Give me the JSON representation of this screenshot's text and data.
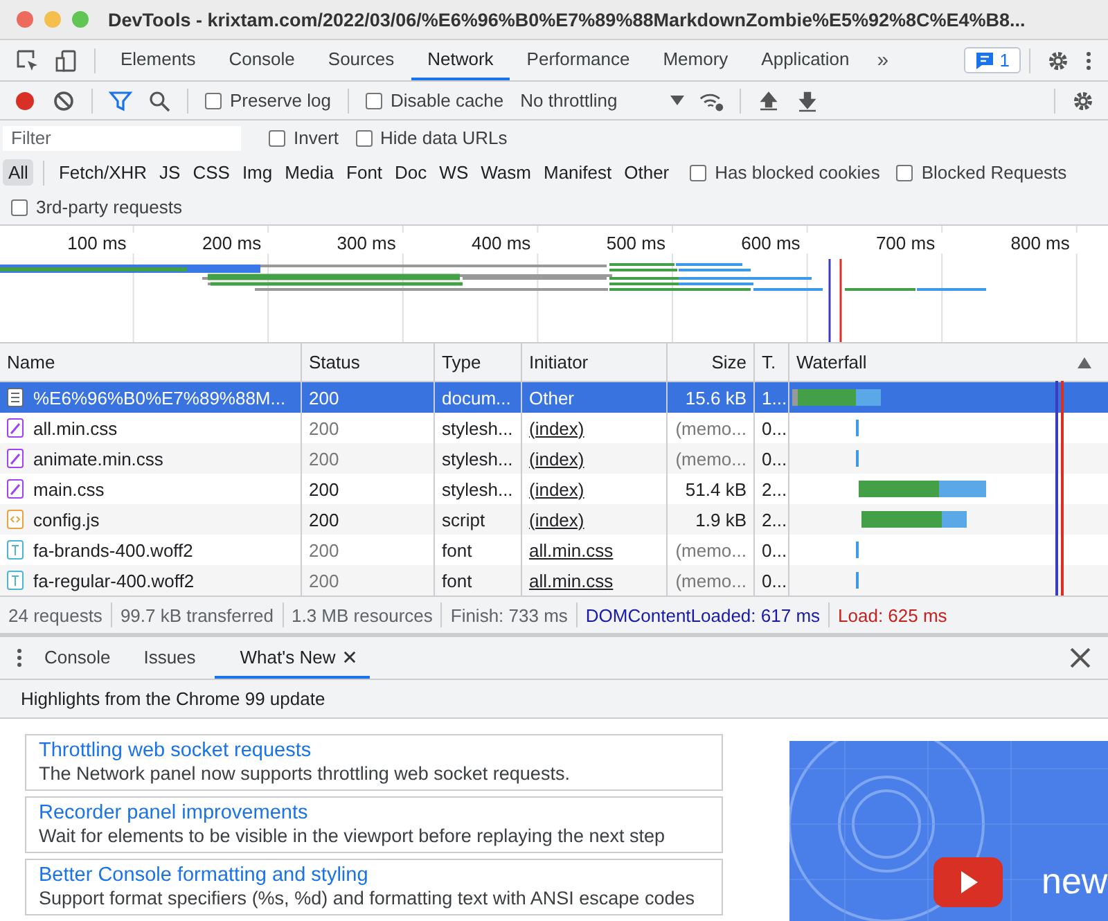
{
  "window": {
    "title": "DevTools - krixtam.com/2022/03/06/%E6%96%B0%E7%89%88MarkdownZombie%E5%92%8C%E4%B8..."
  },
  "tabs": [
    {
      "label": "Elements",
      "selected": false
    },
    {
      "label": "Console",
      "selected": false
    },
    {
      "label": "Sources",
      "selected": false
    },
    {
      "label": "Network",
      "selected": true
    },
    {
      "label": "Performance",
      "selected": false
    },
    {
      "label": "Memory",
      "selected": false
    },
    {
      "label": "Application",
      "selected": false
    }
  ],
  "more_tabs": "»",
  "issues_badge": "1",
  "toolbar": {
    "preserve_log": {
      "label": "Preserve log",
      "checked": false
    },
    "disable_cache": {
      "label": "Disable cache",
      "checked": false
    },
    "throttling": "No throttling"
  },
  "filter": {
    "placeholder": "Filter",
    "invert": {
      "label": "Invert",
      "checked": false
    },
    "hide_data_urls": {
      "label": "Hide data URLs",
      "checked": false
    }
  },
  "type_filters": [
    {
      "label": "All",
      "selected": true
    },
    {
      "label": "Fetch/XHR",
      "selected": false
    },
    {
      "label": "JS",
      "selected": false
    },
    {
      "label": "CSS",
      "selected": false
    },
    {
      "label": "Img",
      "selected": false
    },
    {
      "label": "Media",
      "selected": false
    },
    {
      "label": "Font",
      "selected": false
    },
    {
      "label": "Doc",
      "selected": false
    },
    {
      "label": "WS",
      "selected": false
    },
    {
      "label": "Wasm",
      "selected": false
    },
    {
      "label": "Manifest",
      "selected": false
    },
    {
      "label": "Other",
      "selected": false
    }
  ],
  "blocked_cookies": {
    "label": "Has blocked cookies",
    "checked": false
  },
  "blocked_requests": {
    "label": "Blocked Requests",
    "checked": false
  },
  "third_party": {
    "label": "3rd-party requests",
    "checked": false
  },
  "overview_ticks": [
    "100 ms",
    "200 ms",
    "300 ms",
    "400 ms",
    "500 ms",
    "600 ms",
    "700 ms",
    "800 ms"
  ],
  "table": {
    "columns": [
      "Name",
      "Status",
      "Type",
      "Initiator",
      "Size",
      "T.",
      "Waterfall"
    ],
    "rows": [
      {
        "kind": "document",
        "name": "%E6%96%B0%E7%89%88M...",
        "status": "200",
        "cached": false,
        "type": "docum...",
        "initiator": "Other",
        "initiator_link": false,
        "size": "15.6 kB",
        "time": "1...",
        "selected": true
      },
      {
        "kind": "stylesheet",
        "name": "all.min.css",
        "status": "200",
        "cached": true,
        "type": "stylesh...",
        "initiator": "(index)",
        "initiator_link": true,
        "size": "(memo...",
        "time": "0...",
        "selected": false
      },
      {
        "kind": "stylesheet",
        "name": "animate.min.css",
        "status": "200",
        "cached": true,
        "type": "stylesh...",
        "initiator": "(index)",
        "initiator_link": true,
        "size": "(memo...",
        "time": "0...",
        "selected": false
      },
      {
        "kind": "stylesheet",
        "name": "main.css",
        "status": "200",
        "cached": false,
        "type": "stylesh...",
        "initiator": "(index)",
        "initiator_link": true,
        "size": "51.4 kB",
        "time": "2...",
        "selected": false
      },
      {
        "kind": "script",
        "name": "config.js",
        "status": "200",
        "cached": false,
        "type": "script",
        "initiator": "(index)",
        "initiator_link": true,
        "size": "1.9 kB",
        "time": "2...",
        "selected": false
      },
      {
        "kind": "font",
        "name": "fa-brands-400.woff2",
        "status": "200",
        "cached": true,
        "type": "font",
        "initiator": "all.min.css",
        "initiator_link": true,
        "size": "(memo...",
        "time": "0...",
        "selected": false
      },
      {
        "kind": "font",
        "name": "fa-regular-400.woff2",
        "status": "200",
        "cached": true,
        "type": "font",
        "initiator": "all.min.css",
        "initiator_link": true,
        "size": "(memo...",
        "time": "0...",
        "selected": false
      }
    ]
  },
  "summary": [
    {
      "kind": "plain",
      "text": "24 requests"
    },
    {
      "kind": "plain",
      "text": "99.7 kB transferred"
    },
    {
      "kind": "plain",
      "text": "1.3 MB resources"
    },
    {
      "kind": "plain",
      "text": "Finish: 733 ms"
    },
    {
      "kind": "dom",
      "text": "DOMContentLoaded: 617 ms"
    },
    {
      "kind": "load",
      "text": "Load: 625 ms"
    }
  ],
  "drawer": {
    "tabs": [
      {
        "label": "Console",
        "selected": false,
        "closable": false
      },
      {
        "label": "Issues",
        "selected": false,
        "closable": false
      },
      {
        "label": "What's New",
        "selected": true,
        "closable": true
      }
    ],
    "heading": "Highlights from the Chrome 99 update",
    "items": [
      {
        "title": "Throttling web socket requests",
        "description": "The Network panel now supports throttling web socket requests."
      },
      {
        "title": "Recorder panel improvements",
        "description": "Wait for elements to be visible in the viewport before replaying the next step"
      },
      {
        "title": "Better Console formatting and styling",
        "description": "Support format specifiers (%s, %d) and formatting text with ANSI escape codes"
      }
    ],
    "video_caption": "new"
  }
}
